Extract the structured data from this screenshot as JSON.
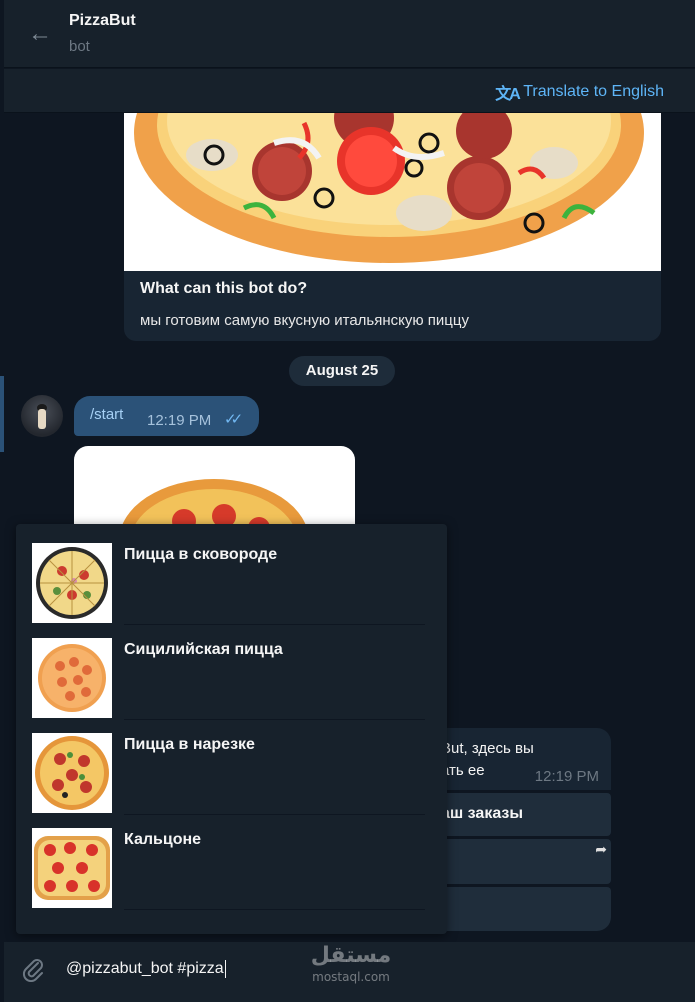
{
  "header": {
    "back_icon": "arrow-left-icon",
    "title": "PizzaBut",
    "subtitle": "bot"
  },
  "translate": {
    "icon": "translate-icon",
    "label": "Translate to English"
  },
  "intro": {
    "title": "What can this bot do?",
    "text": "мы готовим самую вкусную итальянскую пиццу"
  },
  "date_separator": "August 25",
  "outgoing_message": {
    "text": "/start",
    "time": "12:19 PM",
    "status_icon": "double-check-icon"
  },
  "bot_message": {
    "line1": "But, здесь вы",
    "line2": "ать ее",
    "time": "12:19 PM"
  },
  "keyboard_buttons": [
    {
      "label": "аш заказы"
    },
    {
      "label": "",
      "icon": "share-arrow-icon"
    },
    {
      "label": ""
    }
  ],
  "inline_results": [
    {
      "title": "Пицца в сковороде"
    },
    {
      "title": "Сицилийская пицца"
    },
    {
      "title": "Пицца в нарезке"
    },
    {
      "title": "Кальцоне"
    }
  ],
  "composer": {
    "attach_icon": "paperclip-icon",
    "value": "@pizzabut_bot #pizza"
  },
  "watermark": {
    "arabic": "مستقل",
    "latin": "mostaql.com"
  },
  "colors": {
    "background": "#0e1621",
    "panel": "#17212b",
    "accent": "#5eb5f7",
    "outgoing_bubble": "#2b5278"
  }
}
